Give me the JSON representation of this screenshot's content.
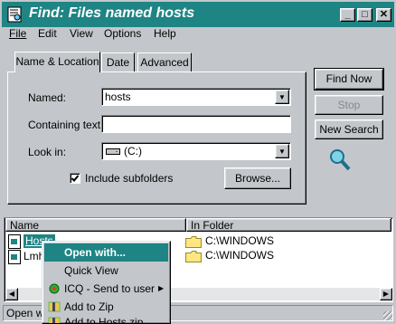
{
  "window": {
    "title": "Find: Files named hosts",
    "min_glyph": "_",
    "max_glyph": "□",
    "close_glyph": "✕"
  },
  "menu": {
    "file": "File",
    "edit": "Edit",
    "view": "View",
    "options": "Options",
    "help": "Help"
  },
  "tabs": {
    "name_location": "Name & Location",
    "date": "Date",
    "advanced": "Advanced"
  },
  "form": {
    "named_label": "Named:",
    "named_value": "hosts",
    "containing_label": "Containing text:",
    "containing_value": "",
    "lookin_label": "Look in:",
    "lookin_value": "(C:)",
    "include_subfolders_label": "Include subfolders",
    "include_subfolders_checked": true,
    "browse_label": "Browse..."
  },
  "actions": {
    "find_now": "Find Now",
    "stop": "Stop",
    "new_search": "New Search"
  },
  "results": {
    "columns": [
      "Name",
      "In Folder"
    ],
    "rows": [
      {
        "name": "Hosts",
        "folder": "C:\\WINDOWS"
      },
      {
        "name": "Lmh",
        "folder": "C:\\WINDOWS"
      }
    ]
  },
  "status": {
    "text": "Open wi"
  },
  "context_menu": {
    "items": [
      {
        "label": "Open with...",
        "icon": "none"
      },
      {
        "label": "Quick View",
        "icon": "none"
      },
      {
        "label": "ICQ - Send to user",
        "icon": "icq-icon"
      },
      {
        "label": "Add to Zip",
        "icon": "zip-icon"
      },
      {
        "label": "Add to Hosts.zip",
        "icon": "zip-icon"
      }
    ]
  },
  "colors": {
    "titlebar": "#1e8484",
    "face": "#c3c7cb",
    "highlight": "#1e8484"
  }
}
